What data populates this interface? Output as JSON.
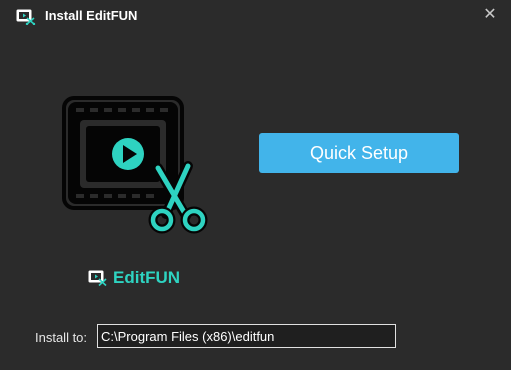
{
  "window": {
    "title": "Install EditFUN",
    "close_glyph": "✕",
    "close_icon": "close-icon",
    "app_icon": "video-scissors-icon"
  },
  "hero": {
    "icon": "film-strip-play-scissors-icon"
  },
  "actions": {
    "quick_setup_label": "Quick Setup"
  },
  "brand": {
    "name": "EditFUN",
    "icon": "video-scissors-icon"
  },
  "install": {
    "label": "Install to:",
    "path": "C:\\Program Files (x86)\\editfun"
  },
  "colors": {
    "background": "#2b2b2b",
    "accent_button": "#42b4ea",
    "brand_teal": "#2ed3c1"
  }
}
